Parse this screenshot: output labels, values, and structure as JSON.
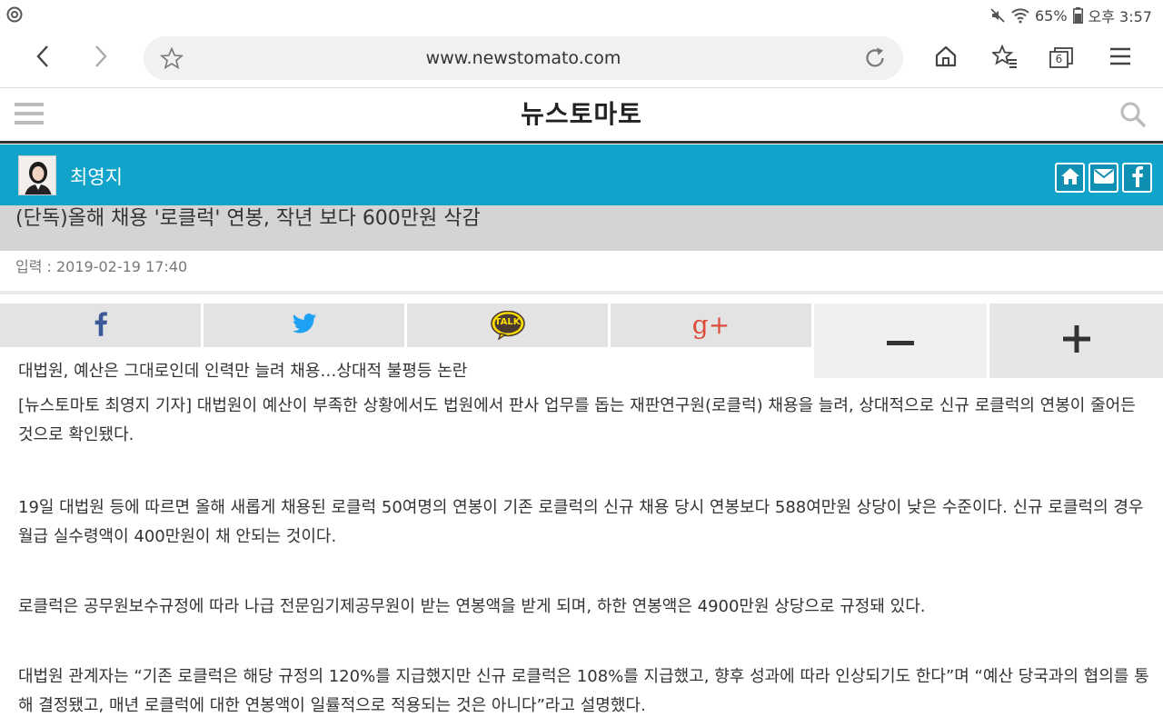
{
  "status_bar": {
    "battery": "65%",
    "time": "오후 3:57",
    "icons": [
      "app-icon",
      "mute-icon",
      "wifi-icon",
      "battery-icon"
    ]
  },
  "browser": {
    "url": "www.newstomato.com",
    "tab_count": "6",
    "icons": [
      "back-icon",
      "forward-icon",
      "bookmark-star-icon",
      "reload-icon",
      "home-icon",
      "bookmarks-icon",
      "tabs-icon",
      "menu-icon"
    ]
  },
  "site": {
    "logo": "뉴스토마토"
  },
  "author": {
    "name": "최영지"
  },
  "article": {
    "title": "(단독)올해 채용 '로클럭' 연봉, 작년 보다 600만원 삭감",
    "date": "입력 : 2019-02-19 17:40",
    "subtitle": "대법원, 예산은 그대로인데 인력만 늘려 채용…상대적 불평등 논란",
    "paragraphs": [
      "[뉴스토마토 최영지 기자] 대법원이 예산이 부족한 상황에서도 법원에서 판사 업무를 돕는 재판연구원(로클럭) 채용을 늘려, 상대적으로 신규 로클럭의 연봉이 줄어든 것으로 확인됐다.",
      "19일 대법원 등에 따르면 올해 새롭게 채용된 로클럭 50여명의 연봉이 기존 로클럭의 신규 채용 당시 연봉보다 588여만원 상당이 낮은 수준이다. 신규 로클럭의 경우 월급 실수령액이 400만원이 채 안되는 것이다.",
      "로클럭은 공무원보수규정에 따라 나급 전문임기제공무원이 받는 연봉액을 받게 되며, 하한 연봉액은 4900만원 상당으로 규정돼 있다.",
      "대법원 관계자는 “기존 로클럭은 해당 규정의 120%를 지급했지만 신규 로클럭은 108%를 지급했고, 향후 성과에 따라 인상되기도 한다”며 “예산 당국과의 협의를 통해 결정됐고, 매년 로클럭에 대한 연봉액이 일률적으로 적용되는 것은 아니다”라고 설명했다."
    ]
  },
  "share": {
    "talk_label": "TALK",
    "gplus_label": "g+"
  },
  "colors": {
    "author_bar": "#11a3c9",
    "facebook": "#3b5998",
    "twitter": "#1da1f2",
    "kakao": "#ffe000",
    "gplus": "#dd4b39"
  }
}
